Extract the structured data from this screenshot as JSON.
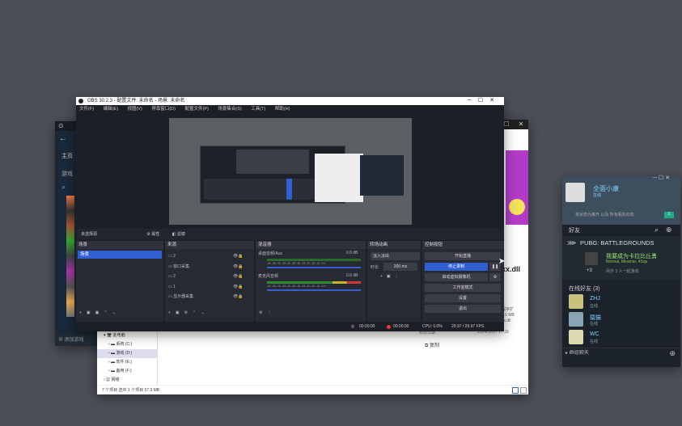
{
  "colors": {
    "desktop": "#4b4f57",
    "obs_bg": "#1d1f26",
    "obs_panel": "#272a33",
    "accent": "#2f5fd3",
    "record_red": "#e83a3a",
    "steam_bg": "#1c222b",
    "pink": "#b13bc7"
  },
  "obs": {
    "title": "OBS 30.2.3 - 配置文件: 未命名 - 场景: 未命名",
    "menu": [
      "文件(F)",
      "编辑(E)",
      "视图(V)",
      "停靠窗口(D)",
      "配置文件(P)",
      "场景集合(S)",
      "工具(T)",
      "帮助(H)"
    ],
    "toolbar": {
      "no_source": "未选择源",
      "props": "属性",
      "filters": "滤镜"
    },
    "docks": {
      "scenes": {
        "title": "场景",
        "items": [
          "场景"
        ]
      },
      "sources": {
        "title": "来源",
        "items": [
          "2",
          "窗口采集",
          "2",
          "1",
          "显示器采集"
        ]
      },
      "mixer": {
        "title": "混音器",
        "ch1": "桌面音频/Aux",
        "ch1_db": "0.0 dB",
        "ch2": "麦克风音频",
        "ch2_db": "0.0 dB",
        "scale": "-60 -55 -50 -45 -40 -35 -30 -25 -20 -15 -10 -5 0"
      },
      "transitions": {
        "title": "转场动画",
        "type": "淡入淡出",
        "duration_label": "时长",
        "duration": "300 ms"
      },
      "controls": {
        "title": "控制按钮",
        "buttons": [
          "开始直播",
          "停止录制",
          "启动虚拟摄像机",
          "工作室模式",
          "设置",
          "退出"
        ]
      }
    },
    "status": {
      "stream_time": "00:00:00",
      "rec_time": "00:00:00",
      "cpu": "CPU: 0.0%",
      "fps": "29.97 / 29.97 FPS"
    }
  },
  "explorer": {
    "tree": [
      "此电脑",
      "系统 (C:)",
      "游戏 (D:)",
      "软件 (E:)",
      "备用 (F:)",
      "网络"
    ],
    "status": "7 个项目   选中 1 个项目  57.9 MB",
    "file_fragment": "xx.dll",
    "date_label": "修改日期",
    "date": "2024/12/27 17:38",
    "meta_frag": [
      "程序扩",
      "1.5 MB",
      "xx.dll"
    ],
    "link": "复制"
  },
  "steam_right": {
    "username": "全面小康",
    "status": "在线",
    "banner_note": "将状态为离开 以及 所有朋友动态",
    "level_badge": "1",
    "friends_label": "好友",
    "game": "PUBG: BATTLEGROUNDS",
    "playing_user": "我要成为卡拉比丘勇",
    "playing_detail": "Normal, Miramar, 4Squ",
    "extra_count": "+3",
    "extra_note": "另外 3 人一起游戏",
    "online_label": "在线好友",
    "online_count": "(3)",
    "friends": [
      {
        "name": "ZHJ",
        "sub": "在线"
      },
      {
        "name": "猿猫",
        "sub": "在线"
      },
      {
        "name": "WC",
        "sub": "在线"
      }
    ],
    "group_chat": "群组聊天"
  },
  "steam_main": {
    "home": "主页",
    "library": "游戏",
    "add_game": "添加游戏"
  }
}
